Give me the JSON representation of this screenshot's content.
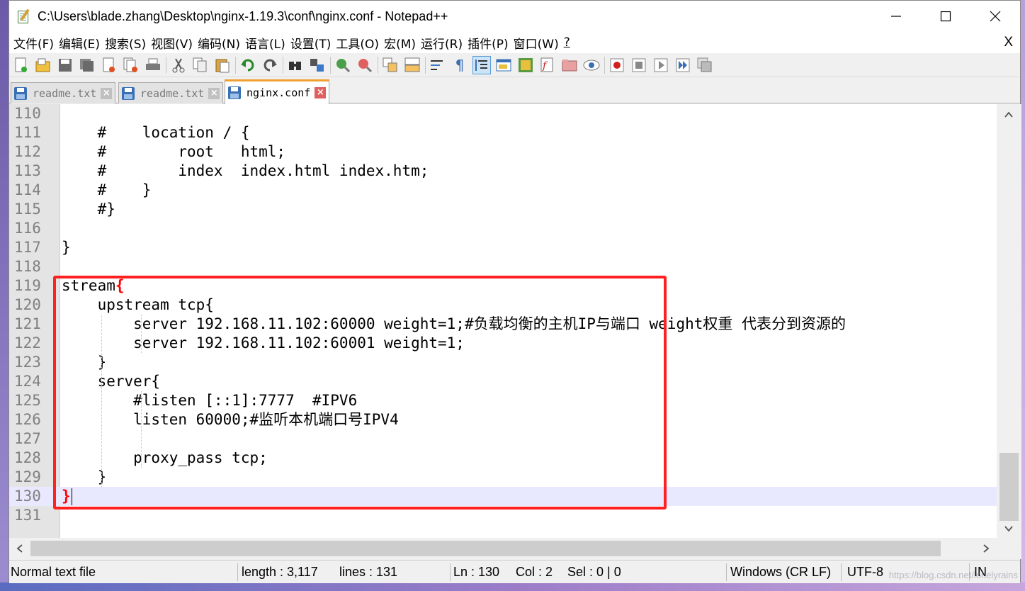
{
  "window": {
    "title": "C:\\Users\\blade.zhang\\Desktop\\nginx-1.19.3\\conf\\nginx.conf - Notepad++"
  },
  "menu": {
    "items": [
      "文件(F)",
      "编辑(E)",
      "搜索(S)",
      "视图(V)",
      "编码(N)",
      "语言(L)",
      "设置(T)",
      "工具(O)",
      "宏(M)",
      "运行(R)",
      "插件(P)",
      "窗口(W)",
      "?"
    ],
    "close_label": "X"
  },
  "toolbar": {
    "icons": [
      "new-file-icon",
      "open-file-icon",
      "save-icon",
      "save-all-icon",
      "close-icon",
      "close-all-icon",
      "print-icon",
      "cut-icon",
      "copy-icon",
      "paste-icon",
      "undo-icon",
      "redo-icon",
      "find-icon",
      "replace-icon",
      "zoom-in-icon",
      "zoom-out-icon",
      "sync-vertical-icon",
      "sync-horizontal-icon",
      "word-wrap-icon",
      "show-all-chars-icon",
      "indent-guide-icon",
      "udl-icon",
      "document-map-icon",
      "function-list-icon",
      "folder-workspace-icon",
      "monitoring-icon",
      "record-macro-icon",
      "stop-record-icon",
      "play-macro-icon",
      "run-macro-multiple-icon",
      "save-macro-icon"
    ]
  },
  "tabs": [
    {
      "label": "readme.txt",
      "active": false
    },
    {
      "label": "readme.txt",
      "active": false
    },
    {
      "label": "nginx.conf",
      "active": true
    }
  ],
  "editor": {
    "current_line": 130,
    "lines": [
      {
        "n": "110",
        "text": ""
      },
      {
        "n": "111",
        "text": "    #    location / {"
      },
      {
        "n": "112",
        "text": "    #        root   html;"
      },
      {
        "n": "113",
        "text": "    #        index  index.html index.htm;"
      },
      {
        "n": "114",
        "text": "    #    }"
      },
      {
        "n": "115",
        "text": "    #}"
      },
      {
        "n": "116",
        "text": ""
      },
      {
        "n": "117",
        "text": "}"
      },
      {
        "n": "118",
        "text": ""
      },
      {
        "n": "119",
        "text": "stream",
        "suffix": "{"
      },
      {
        "n": "120",
        "text": "    upstream tcp{"
      },
      {
        "n": "121",
        "text": "        server 192.168.11.102:60000 weight=1;#负载均衡的主机IP与端口 weight权重 代表分到资源的"
      },
      {
        "n": "122",
        "text": "        server 192.168.11.102:60001 weight=1;"
      },
      {
        "n": "123",
        "text": "    }"
      },
      {
        "n": "124",
        "text": "    server{"
      },
      {
        "n": "125",
        "text": "        #listen [::1]:7777  #IPV6"
      },
      {
        "n": "126",
        "text": "        listen 60000;#监听本机端口号IPV4"
      },
      {
        "n": "127",
        "text": ""
      },
      {
        "n": "128",
        "text": "        proxy_pass tcp;"
      },
      {
        "n": "129",
        "text": "    }"
      },
      {
        "n": "130",
        "text": "",
        "suffix": "}"
      },
      {
        "n": "131",
        "text": ""
      }
    ]
  },
  "status": {
    "file_type": "Normal text file",
    "length": "length : 3,117",
    "lines": "lines : 131",
    "ln": "Ln : 130",
    "col": "Col : 2",
    "sel": "Sel : 0 | 0",
    "eol": "Windows (CR LF)",
    "encoding": "UTF-8",
    "mode": "IN"
  },
  "watermark": "https://blog.csdn.net/lonelyrains",
  "colors": {
    "highlight_box": "#ff2020",
    "brace": "#ff0000",
    "current_line_bg": "#e8e8ff"
  }
}
